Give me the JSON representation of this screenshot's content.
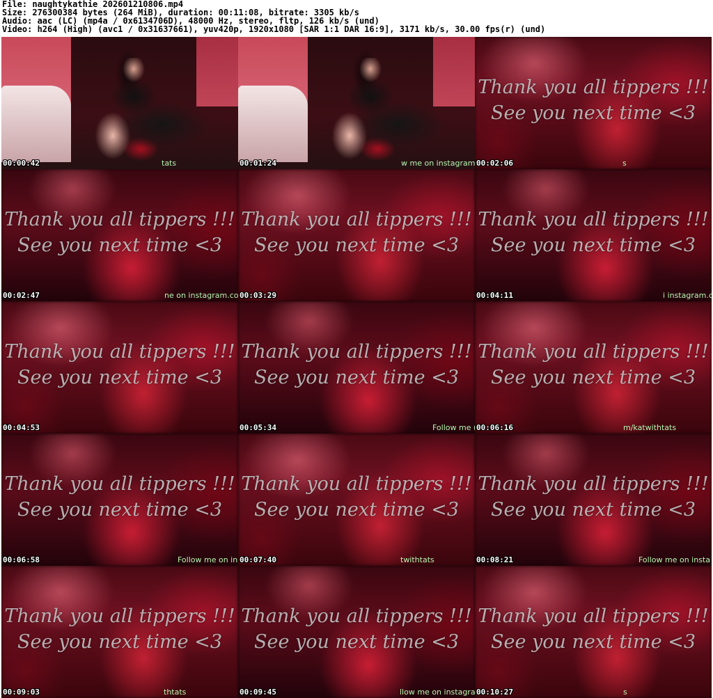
{
  "header": {
    "line1": "File: naughtykathie_202601210806.mp4",
    "line2": "Size: 276300384 bytes (264 MiB), duration: 00:11:08, bitrate: 3305 kb/s",
    "line3": "Audio: aac (LC) (mp4a / 0x6134706D), 48000 Hz, stereo, fltp, 126 kb/s (und)",
    "line4": "Video: h264 (High) (avc1 / 0x31637661), yuv420p, 1920x1080 [SAR 1:1 DAR 16:9], 3171 kb/s, 30.00 fps(r) (und)"
  },
  "overlay_text": {
    "line1": "Thank you all tippers !!!",
    "line2": "See you next time <3"
  },
  "thumbnails": [
    {
      "timestamp": "00:00:42",
      "ticker": "tats",
      "scene": true
    },
    {
      "timestamp": "00:01:24",
      "ticker": "w me on instagram.",
      "scene": true
    },
    {
      "timestamp": "00:02:06",
      "ticker": "s",
      "scene": false
    },
    {
      "timestamp": "00:02:47",
      "ticker": "ne on instagram.cor",
      "scene": false
    },
    {
      "timestamp": "00:03:29",
      "ticker": "",
      "scene": false
    },
    {
      "timestamp": "00:04:11",
      "ticker": "i instagram.com/kat",
      "scene": false
    },
    {
      "timestamp": "00:04:53",
      "ticker": "",
      "scene": false
    },
    {
      "timestamp": "00:05:34",
      "ticker": "Follow me (",
      "scene": false
    },
    {
      "timestamp": "00:06:16",
      "ticker": "m/katwithtats",
      "scene": false
    },
    {
      "timestamp": "00:06:58",
      "ticker": "Follow me on ins",
      "scene": false
    },
    {
      "timestamp": "00:07:40",
      "ticker": "twithtats",
      "scene": false
    },
    {
      "timestamp": "00:08:21",
      "ticker": "Follow me on insta",
      "scene": false
    },
    {
      "timestamp": "00:09:03",
      "ticker": "thtats",
      "scene": false
    },
    {
      "timestamp": "00:09:45",
      "ticker": "llow me on instagra",
      "scene": false
    },
    {
      "timestamp": "00:10:27",
      "ticker": "s",
      "scene": false
    }
  ],
  "colors": {
    "background": "#ffffff",
    "header_text": "#000000",
    "timestamp_text": "#ffffff",
    "ticker_text": "#b7f5b0",
    "overlay_text": "#cdcdcd"
  }
}
